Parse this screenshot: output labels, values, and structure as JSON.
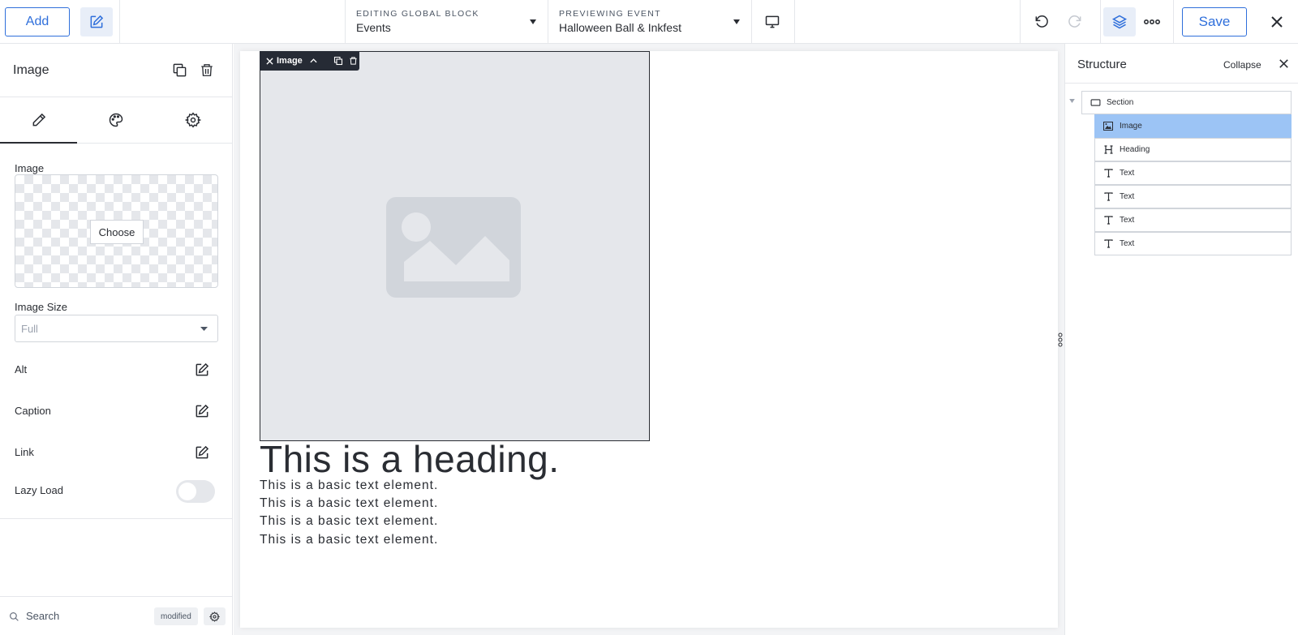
{
  "topbar": {
    "add_label": "Add",
    "global_block": {
      "label": "EDITING GLOBAL BLOCK",
      "value": "Events"
    },
    "preview_event": {
      "label": "PREVIEWING EVENT",
      "value": "Halloween Ball & Inkfest"
    },
    "save_label": "Save",
    "accent_color": "#2f6fdb"
  },
  "left_panel": {
    "title": "Image",
    "tabs": [
      "content",
      "style",
      "settings"
    ],
    "image_label": "Image",
    "choose_label": "Choose",
    "size_label": "Image Size",
    "size_value": "Full",
    "rows": [
      {
        "label": "Alt"
      },
      {
        "label": "Caption"
      },
      {
        "label": "Link"
      }
    ],
    "lazy_label": "Lazy Load",
    "lazy_on": false,
    "search_placeholder": "Search",
    "badge": "modified"
  },
  "canvas": {
    "tag_label": "Image",
    "heading": "This is a heading.",
    "texts": [
      "This is a basic text element.",
      "This is a basic text element.",
      "This is a basic text element.",
      "This is a basic text element."
    ]
  },
  "structure": {
    "title": "Structure",
    "collapse_label": "Collapse",
    "root": {
      "label": "Section",
      "icon": "section-icon"
    },
    "children": [
      {
        "label": "Image",
        "icon": "image-icon",
        "selected": true
      },
      {
        "label": "Heading",
        "icon": "heading-icon",
        "selected": false
      },
      {
        "label": "Text",
        "icon": "text-icon",
        "selected": false
      },
      {
        "label": "Text",
        "icon": "text-icon",
        "selected": false
      },
      {
        "label": "Text",
        "icon": "text-icon",
        "selected": false
      },
      {
        "label": "Text",
        "icon": "text-icon",
        "selected": false
      }
    ],
    "selected_color": "#9cc4f5"
  }
}
